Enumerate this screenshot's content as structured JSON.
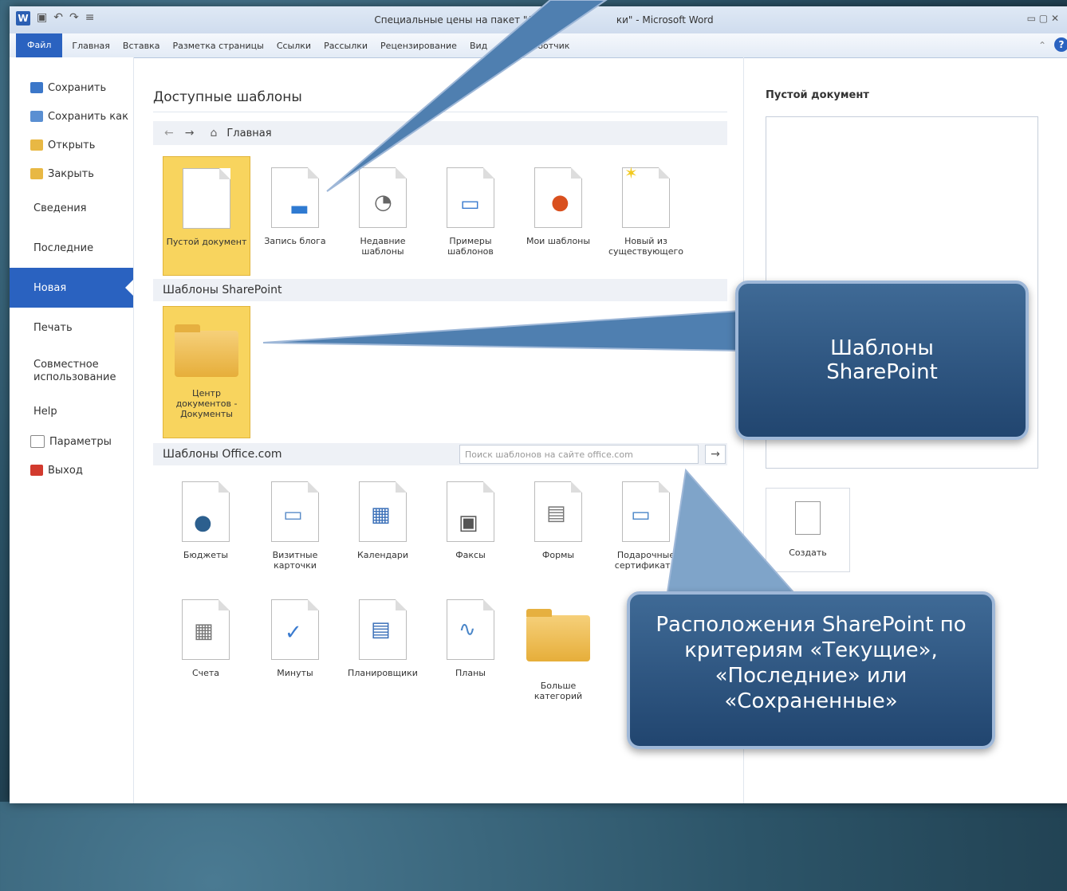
{
  "window": {
    "title": "Специальные цены на пакет \"Джунгли\" - Microsoft Word",
    "title_left": "Специальные цены на пакет \"Джунг",
    "title_right": "ки\" - Microsoft Word"
  },
  "ribbon": {
    "file": "Файл",
    "tabs": [
      "Главная",
      "Вставка",
      "Разметка страницы",
      "Ссылки",
      "Рассылки",
      "Рецензирование",
      "Вид",
      "Разработчик"
    ]
  },
  "backstage": {
    "items": [
      "Сохранить",
      "Сохранить как",
      "Открыть",
      "Закрыть",
      "Сведения",
      "Последние",
      "Новая",
      "Печать",
      "Совместное использование",
      "Help",
      "Параметры",
      "Выход"
    ]
  },
  "main": {
    "heading": "Доступные шаблоны",
    "nav_home": "Главная",
    "top_tiles": [
      "Пустой документ",
      "Запись блога",
      "Недавние шаблоны",
      "Примеры шаблонов",
      "Мои шаблоны",
      "Новый из существующего"
    ],
    "sharepoint_header": "Шаблоны SharePoint",
    "sharepoint_tile": "Центр документов - Документы",
    "office_header": "Шаблоны Office.com",
    "search_placeholder": "Поиск шаблонов на сайте office.com",
    "office_row1": [
      "Бюджеты",
      "Визитные карточки",
      "Календари",
      "Факсы",
      "Формы",
      "Подарочные сертификаты"
    ],
    "office_row2": [
      "Счета",
      "Минуты",
      "Планировщики",
      "Планы",
      "Больше категорий"
    ]
  },
  "preview": {
    "title": "Пустой документ",
    "create": "Создать"
  },
  "callouts": {
    "sharepoint_line1": "Шаблоны",
    "sharepoint_line2": "SharePoint",
    "locations": "Расположения SharePoint по критериям «Текущие», «Последние» или «Сохраненные»"
  },
  "colors": {
    "accent": "#2a62c0",
    "selected_tile": "#f8d45e",
    "callout": "#2f5684"
  }
}
